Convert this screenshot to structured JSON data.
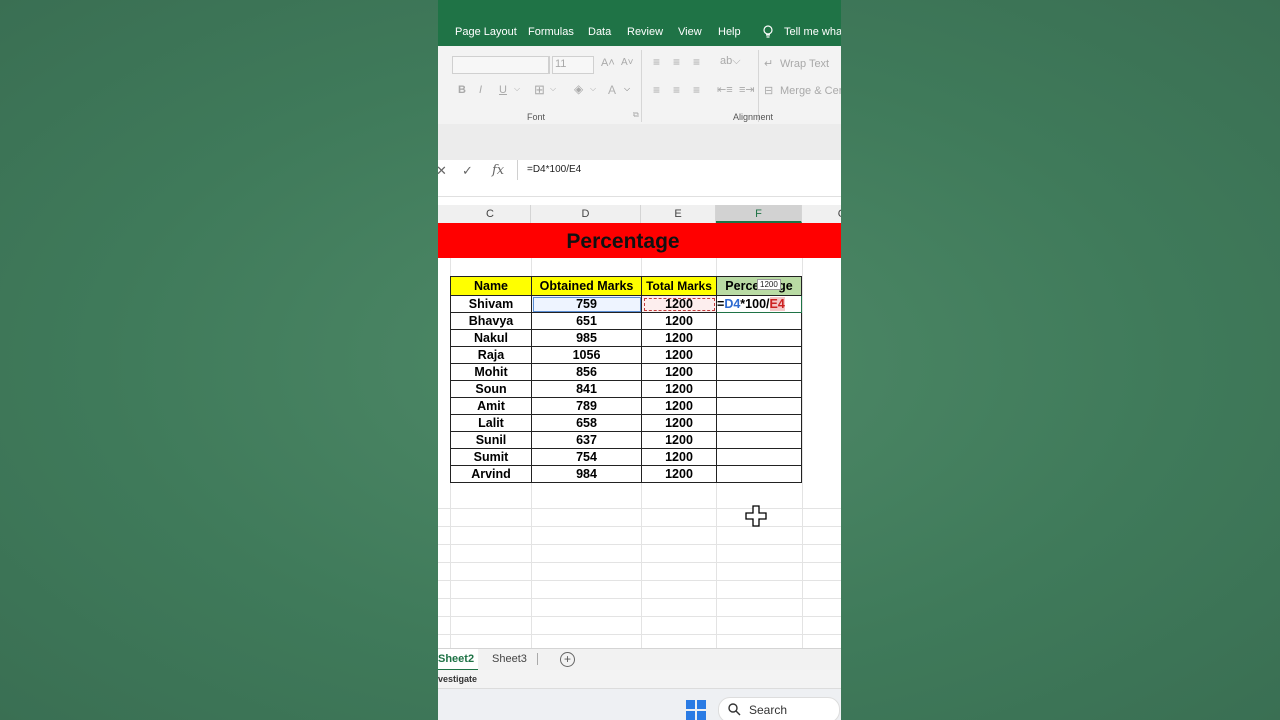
{
  "ribbon_tabs": [
    "Page Layout",
    "Formulas",
    "Data",
    "Review",
    "View",
    "Help"
  ],
  "tell_me": "Tell me what",
  "font_size": "11",
  "font_buttons": {
    "bold": "B",
    "italic": "I",
    "underline": "U"
  },
  "wrap_text": "Wrap Text",
  "merge_center": "Merge & Cen",
  "group_labels": {
    "font": "Font",
    "alignment": "Alignment"
  },
  "formula_bar": {
    "cancel": "✕",
    "enter": "✓",
    "fx": "fx",
    "formula": "=D4*100/E4"
  },
  "columns": [
    "C",
    "D",
    "E",
    "F",
    "G"
  ],
  "title": "Percentage",
  "table": {
    "headers": [
      "Name",
      "Obtained Marks",
      "Total Marks",
      "Percentage"
    ],
    "rows": [
      [
        "Shivam",
        "759",
        "1200"
      ],
      [
        "Bhavya",
        "651",
        "1200"
      ],
      [
        "Nakul",
        "985",
        "1200"
      ],
      [
        "Raja",
        "1056",
        "1200"
      ],
      [
        "Mohit",
        "856",
        "1200"
      ],
      [
        "Soun",
        "841",
        "1200"
      ],
      [
        "Amit",
        "789",
        "1200"
      ],
      [
        "Lalit",
        "658",
        "1200"
      ],
      [
        "Sunil",
        "637",
        "1200"
      ],
      [
        "Sumit",
        "754",
        "1200"
      ],
      [
        "Arvind",
        "984",
        "1200"
      ]
    ],
    "editing_parts": {
      "eq": "=",
      "ref1": "D4",
      "mid": "*100/",
      "ref2": "E4"
    },
    "tooltip": "1200"
  },
  "sheets": [
    "Sheet2",
    "Sheet3"
  ],
  "status_text": "vestigate",
  "taskbar": {
    "search": "Search"
  },
  "colors": {
    "excel_green": "#1f7346",
    "title_red": "#ff0000",
    "header_yellow": "#ffff00",
    "header_green": "#b9dba4"
  }
}
